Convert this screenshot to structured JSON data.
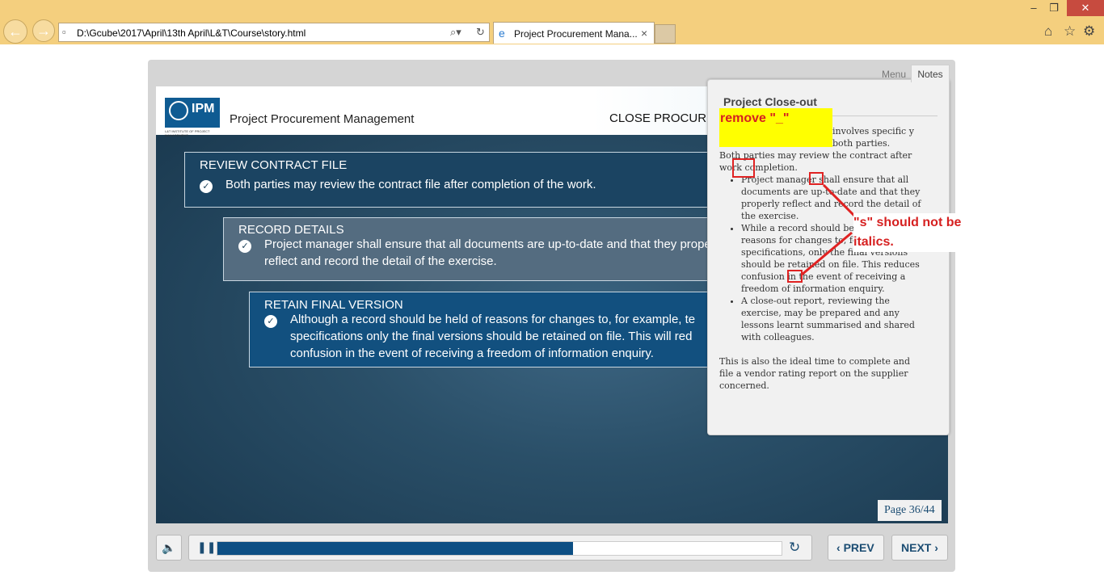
{
  "browser": {
    "address": "D:\\Gcube\\2017\\April\\13th April\\L&T\\Course\\story.html",
    "tab_title": "Project Procurement Mana...",
    "tab_close": "×"
  },
  "header": {
    "logo_text": "IPM",
    "logo_sub": "L&T INSTITUTE OF PROJECT MANAGEMENT",
    "course_title": "Project Procurement Management",
    "section_title": "CLOSE PROCUREM"
  },
  "boxes": [
    {
      "title": "REVIEW CONTRACT FILE",
      "text": "Both parties may review the contract file after completion of the work."
    },
    {
      "title": "RECORD DETAILS",
      "text": "Project manager shall ensure  that all documents are up-to-date and that they properly reflect and record the detail of the exercise."
    },
    {
      "title": "RETAIN FINAL VERSION",
      "text": "Although a record should be held of reasons for changes to, for example, te specifications only the final versions should be retained on file. This will red confusion in the event of receiving a freedom of information enquiry."
    }
  ],
  "notes": {
    "menu_tab": "Menu",
    "notes_tab": "Notes",
    "title": "Project Close-out",
    "intro": "involves specific y both parties.",
    "para1": "Both parties may review the contract after work completion.",
    "bullets": [
      "Project manager shall ensure  that all documents are up-to-date and that they properly reflect and record the detail of the exercise.",
      "While a record should be held of reasons for changes to, for tender specifications, only the final versions should be retained on file. This reduces confusion in the event of receiving a freedom of information enquiry.",
      "A close-out report, reviewing the exercise, may be prepared and any lessons learnt summarised and shared with colleagues."
    ],
    "closing": "This is also the ideal time to complete and file a vendor rating report on the supplier concerned."
  },
  "annotations": {
    "remove": "remove \"_\"",
    "s_note": "\"s\" should not be italics."
  },
  "controls": {
    "page": "Page 36/44",
    "prev": "PREV",
    "next": "NEXT",
    "progress": 0.63
  }
}
